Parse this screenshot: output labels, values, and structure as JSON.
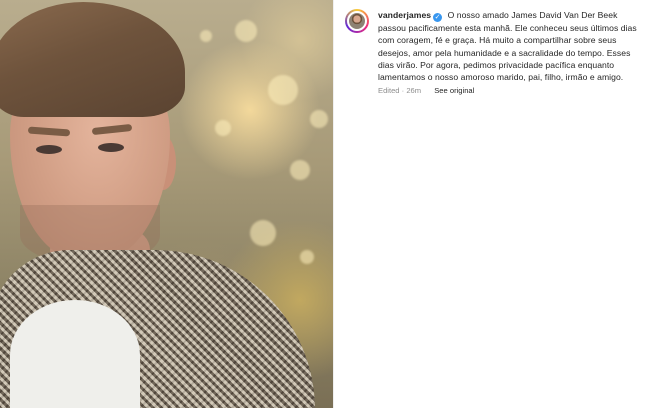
{
  "post": {
    "author": {
      "username": "vanderjames",
      "verified": true,
      "verified_icon": "verified-badge-icon"
    },
    "caption": "O nosso amado James David Van Der Beek passou pacificamente esta manhã. Ele conheceu seus últimos dias com coragem, fé e graça. Há muito a compartilhar sobre seus desejos, amor pela humanidade e a sacralidade do tempo. Esses dias virão. Por agora, pedimos privacidade pacífica enquanto lamentamos o nosso amoroso marido, pai, filho, irmão e amigo.",
    "meta": {
      "edited": "Edited",
      "separator": "·",
      "time": "26m",
      "see_original": "See original"
    }
  },
  "colors": {
    "verified_blue": "#3897f0",
    "text": "#262626",
    "muted": "#8e8e8e"
  }
}
